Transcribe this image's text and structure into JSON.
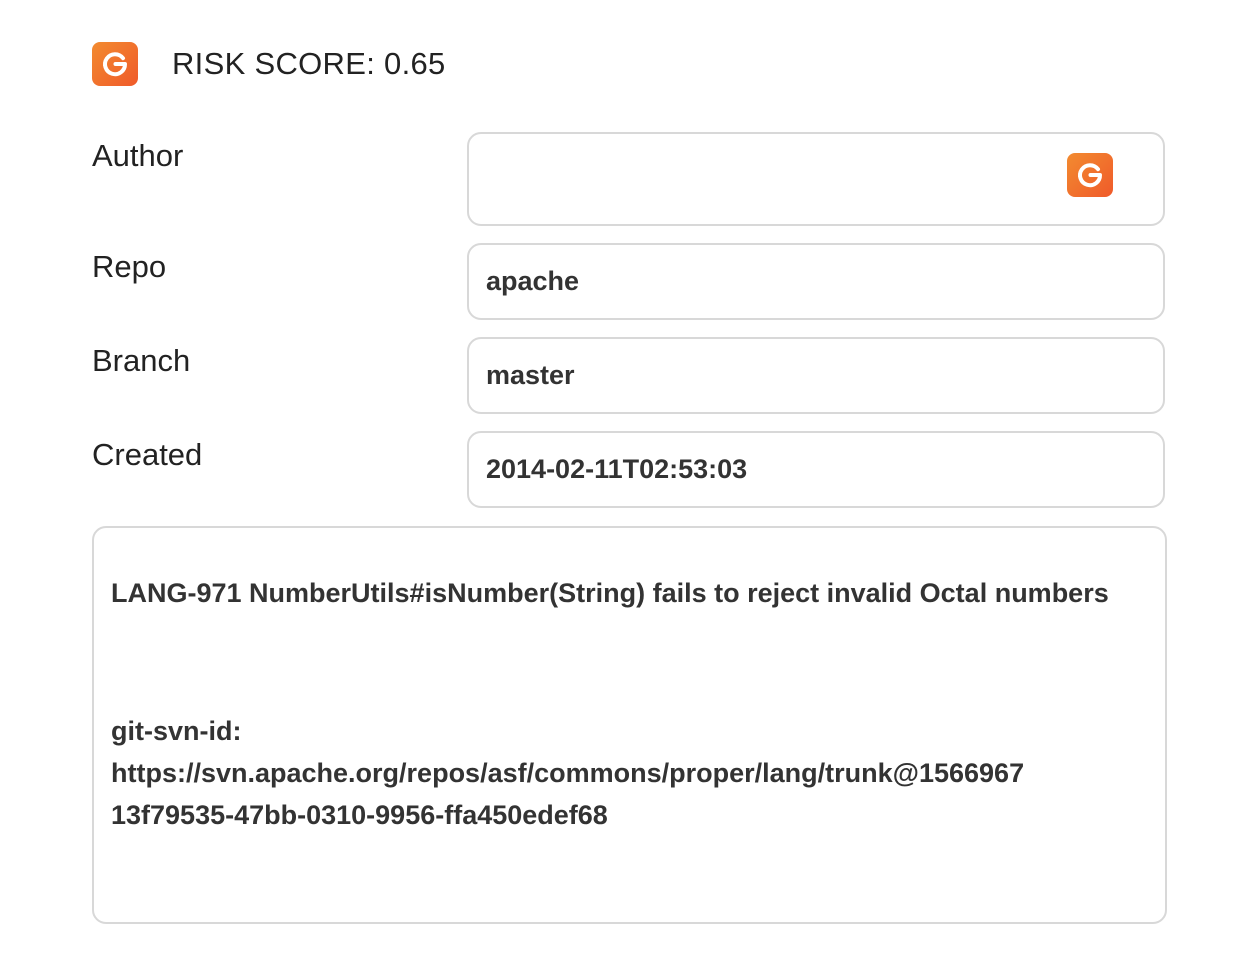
{
  "header": {
    "logo_icon": "grammarly-g-icon",
    "title": "RISK SCORE: 0.65"
  },
  "fields": {
    "author": {
      "label": "Author",
      "value": "",
      "icon": "grammarly-g-icon"
    },
    "repo": {
      "label": "Repo",
      "value": "apache"
    },
    "branch": {
      "label": "Branch",
      "value": "master"
    },
    "created": {
      "label": "Created",
      "value": "2014-02-11T02:53:03"
    }
  },
  "message": {
    "summary": "LANG-971 NumberUtils#isNumber(String) fails to reject invalid Octal numbers",
    "svn_label": "git-svn-id:",
    "svn_url": "https://svn.apache.org/repos/asf/commons/proper/lang/trunk@1566967",
    "svn_uuid": "13f79535-47bb-0310-9956-ffa450edef68"
  },
  "colors": {
    "logo_gradient_start": "#f28b30",
    "logo_gradient_end": "#f05a2a",
    "border": "#d8d8d8",
    "text": "#333333"
  }
}
